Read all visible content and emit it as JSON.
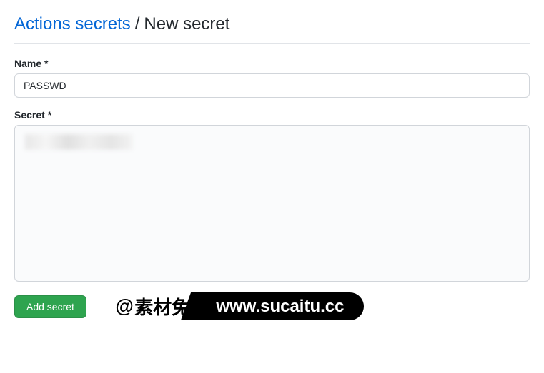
{
  "header": {
    "link_text": "Actions secrets",
    "separator": "/",
    "current": "New secret"
  },
  "form": {
    "name_label": "Name *",
    "name_value": "PASSWD",
    "secret_label": "Secret *",
    "submit_label": "Add secret"
  },
  "watermark": {
    "prefix": "@",
    "cn_text": "素材兔",
    "url": "www.sucaitu.cc"
  }
}
